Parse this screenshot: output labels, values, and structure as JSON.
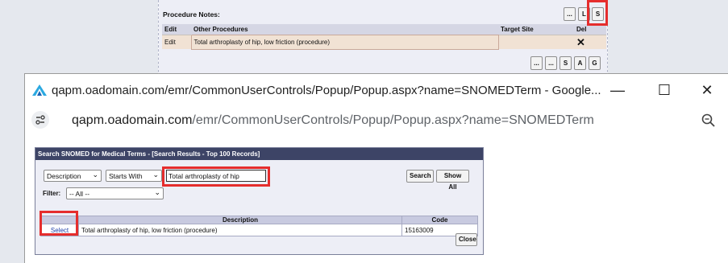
{
  "background_page": {
    "procedure_notes_label": "Procedure Notes:",
    "top_buttons": [
      "...",
      "L",
      "S"
    ],
    "table": {
      "headers": [
        "Edit",
        "Other Procedures",
        "Target Site",
        "Del"
      ],
      "rows": [
        {
          "edit": "Edit",
          "procedure": "Total arthroplasty of hip, low friction (procedure)",
          "target_site": "",
          "del": "✕"
        }
      ]
    },
    "bottom_buttons": [
      "...",
      "...",
      "S",
      "A",
      "G"
    ]
  },
  "popup": {
    "title": "qapm.oadomain.com/emr/CommonUserControls/Popup/Popup.aspx?name=SNOMEDTerm - Google...",
    "window_controls": {
      "minimize": "—",
      "maximize": "☐",
      "close": "✕"
    },
    "url_host": "qapm.oadomain.com",
    "url_path": "/emr/CommonUserControls/Popup/Popup.aspx?name=SNOMEDTerm",
    "zoom_icon": "zoom-out-icon"
  },
  "search": {
    "header": "Search SNOMED for Medical Terms - [Search Results - Top 100 Records]",
    "field_select": "Description",
    "mode_select": "Starts With",
    "query": "Total arthroplasty of hip",
    "search_button": "Search",
    "show_all_button": "Show All",
    "filter_label": "Filter:",
    "filter_value": "-- All --",
    "results": {
      "headers": [
        "",
        "Description",
        "Code"
      ],
      "rows": [
        {
          "action": "Select",
          "description": "Total arthroplasty of hip, low friction (procedure)",
          "code": "15163009"
        }
      ]
    },
    "close_button": "Close"
  },
  "colors": {
    "highlight": "#e52d2d",
    "panel_header": "#3d4466",
    "link": "#1f3fa8",
    "row_tint": "#f1e2d4"
  }
}
